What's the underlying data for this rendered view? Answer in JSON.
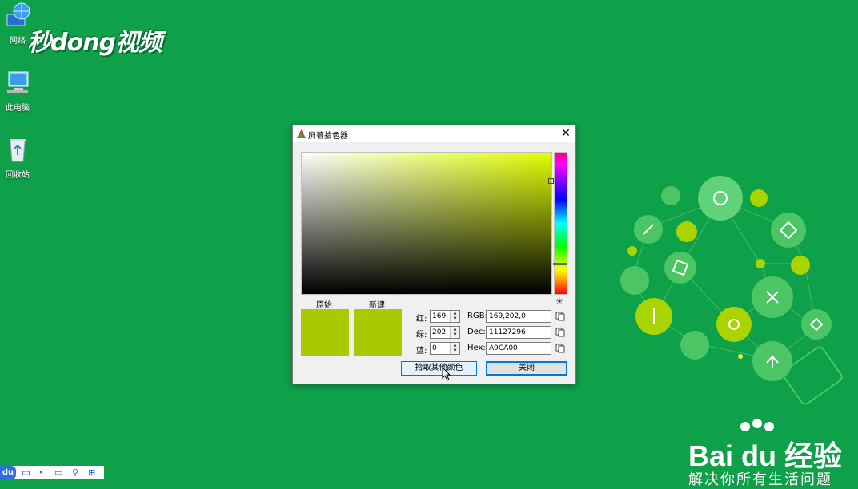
{
  "desktop": {
    "icons": [
      {
        "label": "网络",
        "icon": "network-globe-icon"
      },
      {
        "label": "此电脑",
        "icon": "computer-icon"
      },
      {
        "label": "回收站",
        "icon": "recycle-bin-icon"
      }
    ],
    "watermark": "秒dong视频",
    "baidu": {
      "brand": "Bai du 经验",
      "slogan": "解决你所有生活问题"
    }
  },
  "dialog": {
    "title": "屏幕拾色器",
    "close_glyph": "✕",
    "current_hue_hex": "#DFFF00",
    "swatches": {
      "original_label": "原始",
      "new_label": "新建",
      "original_color": "#A9CA00",
      "new_color": "#A9CA00"
    },
    "fields": {
      "red_label": "红:",
      "green_label": "绿:",
      "blue_label": "蓝:",
      "red_value": "169",
      "green_value": "202",
      "blue_value": "0",
      "rgb_label": "RGB:",
      "dec_label": "Dec:",
      "hex_label": "Hex:",
      "rgb_value": "169,202,0",
      "dec_value": "11127296",
      "hex_value": "A9CA00"
    },
    "buttons": {
      "pick_label": "拾取其他颜色",
      "close_label": "关闭"
    }
  },
  "taskbar": {
    "du_label": "du",
    "items": [
      "中",
      "•",
      "▭",
      "♀",
      "⊞"
    ]
  },
  "colors": {
    "desktop_bg": "#0FA04A",
    "accent": "#0078D7"
  }
}
